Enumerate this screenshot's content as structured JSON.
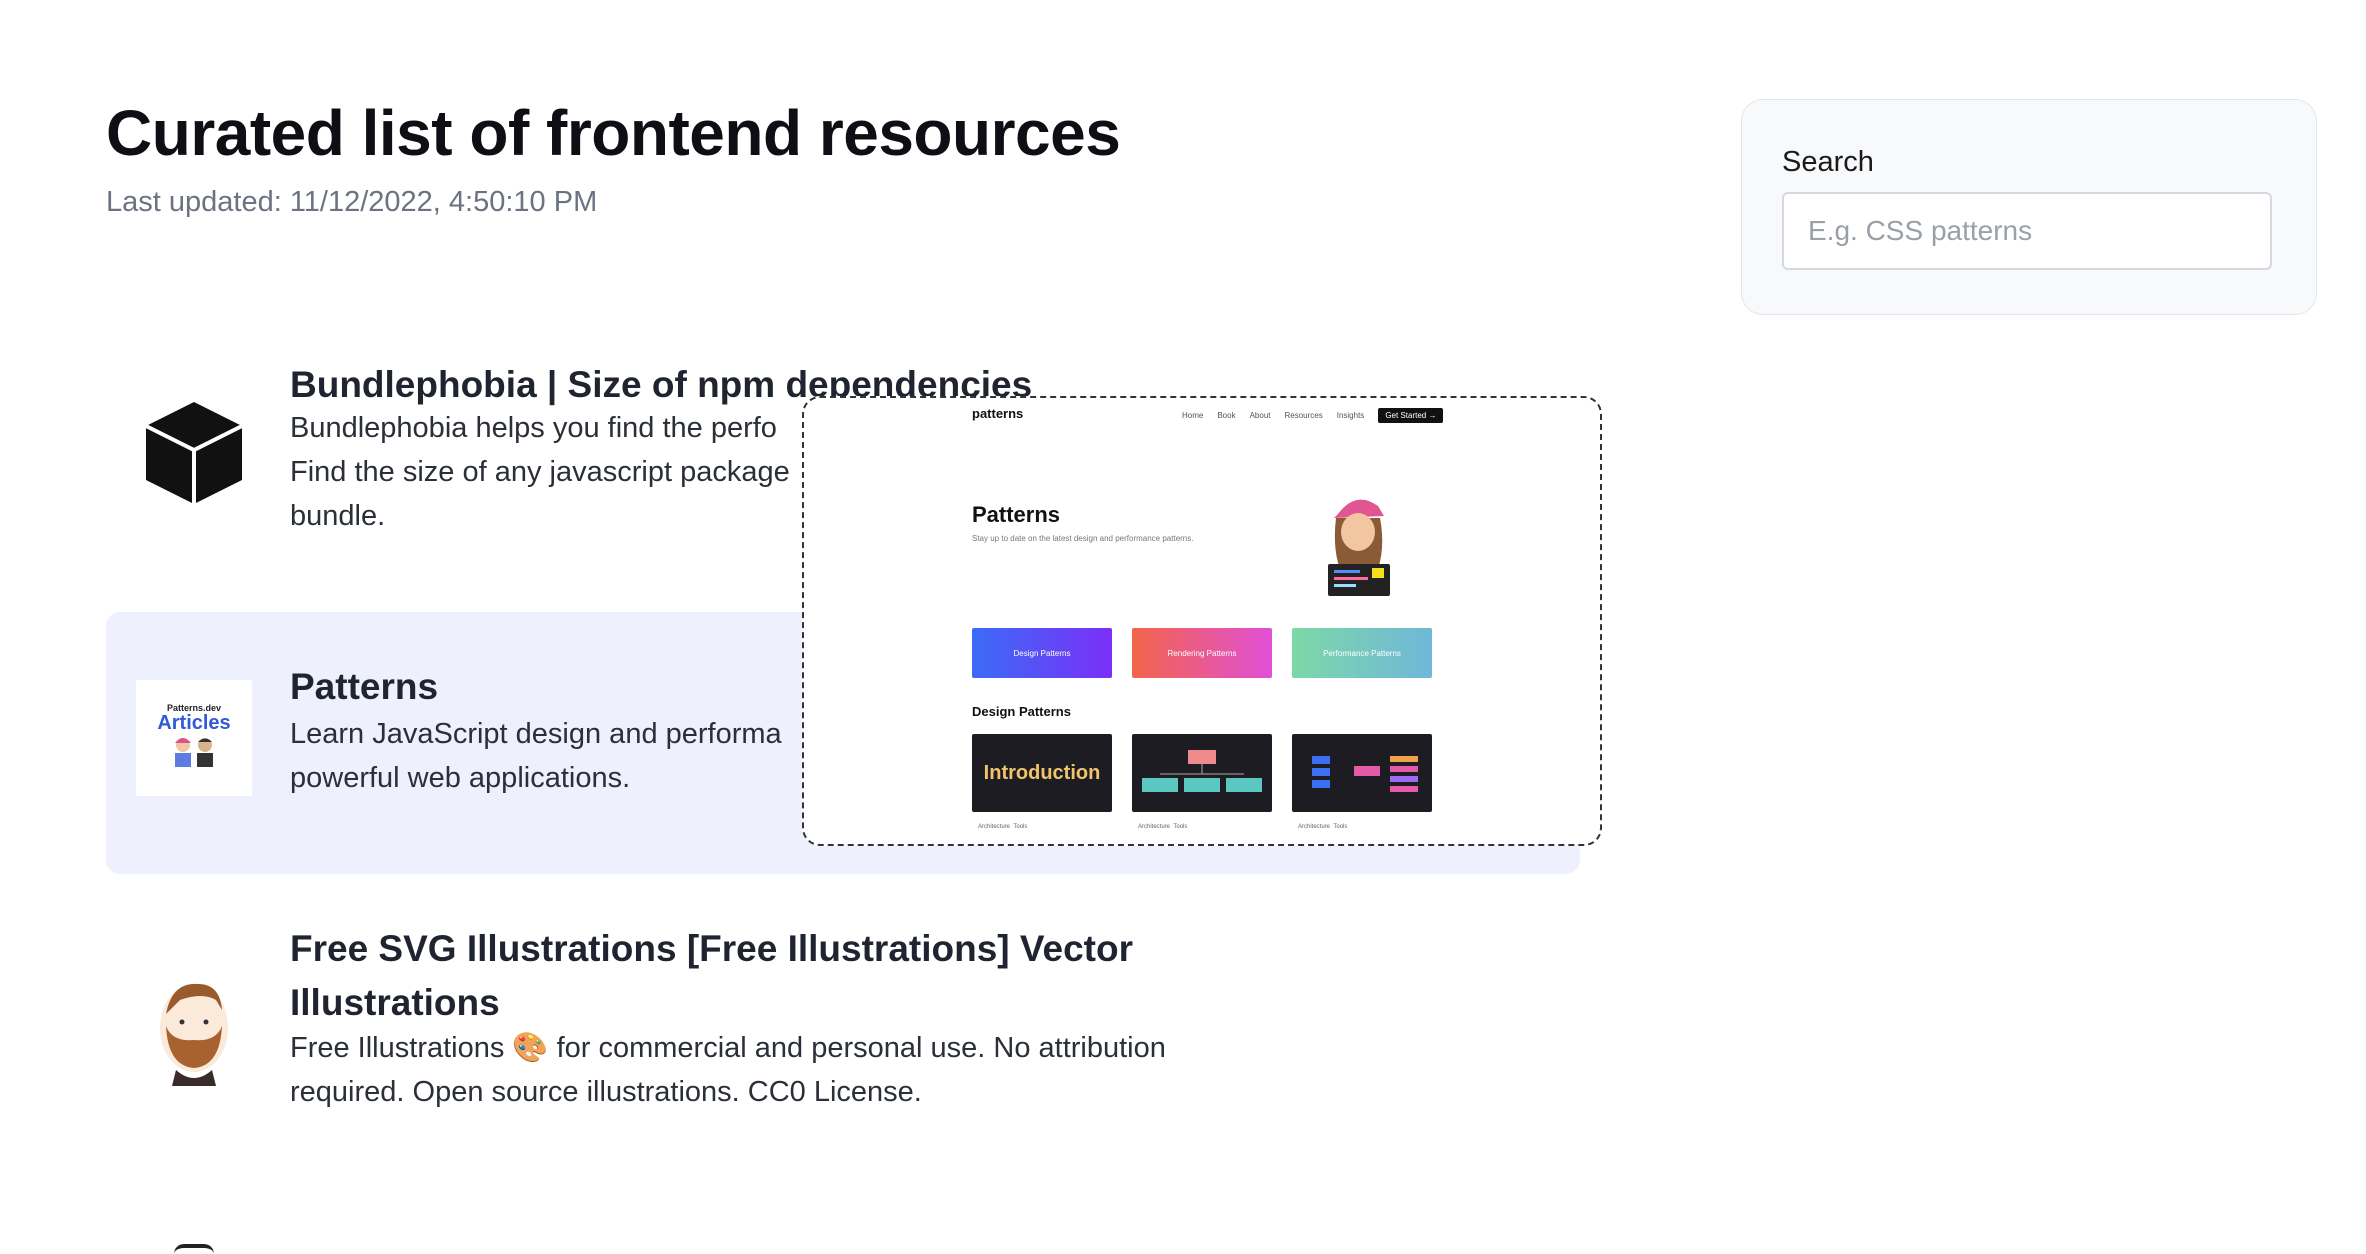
{
  "header": {
    "title": "Curated list of frontend resources",
    "last_updated": "Last updated: 11/12/2022, 4:50:10 PM"
  },
  "search": {
    "label": "Search",
    "placeholder": "E.g. CSS patterns"
  },
  "items": [
    {
      "title": "Bundlephobia | Size of npm dependencies",
      "desc_lines": [
        "Bundlephobia helps you find the perfo",
        "Find the size of any javascript package",
        "bundle."
      ],
      "icon": "cube-icon"
    },
    {
      "title": "Patterns",
      "desc_lines": [
        "Learn JavaScript design and performa",
        "powerful web applications."
      ],
      "icon": "patterns-articles-thumbnail",
      "thumb_top": "Patterns.dev",
      "thumb_main": "Articles"
    },
    {
      "title_lines": [
        "Free SVG Illustrations [Free Illustrations] Vector",
        "Illustrations"
      ],
      "desc_lines": [
        "Free Illustrations 🎨 for commercial and personal use. No attribution",
        "required. Open source illustrations. CC0 License."
      ],
      "icon": "bearded-man-avatar-icon"
    }
  ],
  "preview": {
    "logo": "patterns",
    "nav": [
      "Home",
      "Book",
      "About",
      "Resources",
      "Insights"
    ],
    "cta": "Get Started →",
    "heading": "Patterns",
    "subheading": "Stay up to date on the latest design and performance patterns.",
    "buttons": [
      {
        "label": "Design Patterns",
        "from": "#3b6cf6",
        "to": "#7b2ff7"
      },
      {
        "label": "Rendering Patterns",
        "from": "#f2654a",
        "to": "#e04fd6"
      },
      {
        "label": "Performance Patterns",
        "from": "#7dd8a7",
        "to": "#6fb7d9"
      }
    ],
    "section_title": "Design Patterns",
    "card1_text": "Introduction",
    "card_meta": [
      "Architecture",
      "Tools"
    ]
  }
}
